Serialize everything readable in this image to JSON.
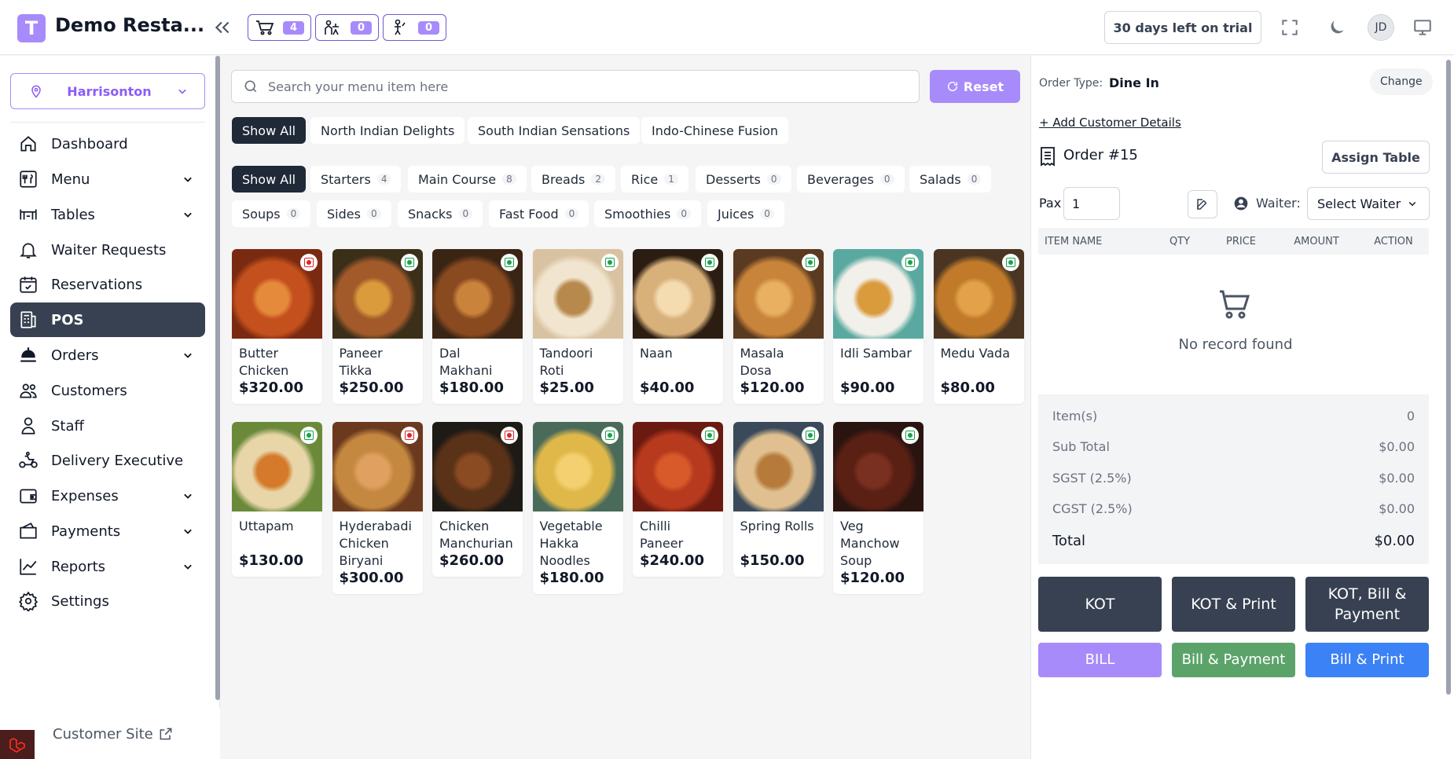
{
  "app": {
    "logo_letter": "T",
    "title": "Demo Resta...",
    "counters": [
      {
        "icon": "cart-icon",
        "value": "4"
      },
      {
        "icon": "waiter-request-icon",
        "value": "0"
      },
      {
        "icon": "table-request-icon",
        "value": "0"
      }
    ],
    "trial_text": "30 days left on trial",
    "avatar_initials": "JD"
  },
  "sidebar": {
    "branch": "Harrisonton",
    "items": [
      {
        "label": "Dashboard",
        "icon": "home-icon",
        "has_children": false
      },
      {
        "label": "Menu",
        "icon": "menu-icon",
        "has_children": true
      },
      {
        "label": "Tables",
        "icon": "table-icon",
        "has_children": true
      },
      {
        "label": "Waiter Requests",
        "icon": "bell-icon",
        "has_children": false
      },
      {
        "label": "Reservations",
        "icon": "calendar-icon",
        "has_children": false
      },
      {
        "label": "POS",
        "icon": "pos-icon",
        "has_children": false,
        "active": true
      },
      {
        "label": "Orders",
        "icon": "orders-icon",
        "has_children": true
      },
      {
        "label": "Customers",
        "icon": "users-icon",
        "has_children": false
      },
      {
        "label": "Staff",
        "icon": "staff-icon",
        "has_children": false
      },
      {
        "label": "Delivery Executive",
        "icon": "delivery-icon",
        "has_children": false
      },
      {
        "label": "Expenses",
        "icon": "wallet-icon",
        "has_children": true
      },
      {
        "label": "Payments",
        "icon": "payments-icon",
        "has_children": true
      },
      {
        "label": "Reports",
        "icon": "chart-icon",
        "has_children": true
      },
      {
        "label": "Settings",
        "icon": "gear-icon",
        "has_children": false
      }
    ],
    "customer_site": "Customer Site"
  },
  "search": {
    "placeholder": "Search your menu item here",
    "value": ""
  },
  "reset_label": "Reset",
  "menus": [
    "Show All",
    "North Indian Delights",
    "South Indian Sensations",
    "Indo-Chinese Fusion"
  ],
  "categories": [
    {
      "label": "Show All"
    },
    {
      "label": "Starters",
      "count": "4"
    },
    {
      "label": "Main Course",
      "count": "8"
    },
    {
      "label": "Breads",
      "count": "2"
    },
    {
      "label": "Rice",
      "count": "1"
    },
    {
      "label": "Desserts",
      "count": "0"
    },
    {
      "label": "Beverages",
      "count": "0"
    },
    {
      "label": "Salads",
      "count": "0"
    },
    {
      "label": "Soups",
      "count": "0"
    },
    {
      "label": "Sides",
      "count": "0"
    },
    {
      "label": "Snacks",
      "count": "0"
    },
    {
      "label": "Fast Food",
      "count": "0"
    },
    {
      "label": "Smoothies",
      "count": "0"
    },
    {
      "label": "Juices",
      "count": "0"
    }
  ],
  "items": [
    {
      "name": "Butter Chicken",
      "price": "$320.00",
      "type": "non-veg"
    },
    {
      "name": "Paneer Tikka",
      "price": "$250.00",
      "type": "veg"
    },
    {
      "name": "Dal Makhani",
      "price": "$180.00",
      "type": "veg"
    },
    {
      "name": "Tandoori Roti",
      "price": "$25.00",
      "type": "veg"
    },
    {
      "name": "Naan",
      "price": "$40.00",
      "type": "veg"
    },
    {
      "name": "Masala Dosa",
      "price": "$120.00",
      "type": "veg"
    },
    {
      "name": "Idli Sambar",
      "price": "$90.00",
      "type": "veg"
    },
    {
      "name": "Medu Vada",
      "price": "$80.00",
      "type": "veg"
    },
    {
      "name": "Uttapam",
      "price": "$130.00",
      "type": "veg"
    },
    {
      "name": "Hyderabadi Chicken Biryani",
      "price": "$300.00",
      "type": "non-veg"
    },
    {
      "name": "Chicken Manchurian",
      "price": "$260.00",
      "type": "non-veg"
    },
    {
      "name": "Vegetable Hakka Noodles",
      "price": "$180.00",
      "type": "veg"
    },
    {
      "name": "Chilli Paneer",
      "price": "$240.00",
      "type": "veg"
    },
    {
      "name": "Spring Rolls",
      "price": "$150.00",
      "type": "veg"
    },
    {
      "name": "Veg Manchow Soup",
      "price": "$120.00",
      "type": "veg"
    }
  ],
  "order": {
    "type_label": "Order Type:",
    "type_value": "Dine In",
    "change_label": "Change",
    "add_customer": "+ Add Customer Details",
    "title": "Order #15",
    "assign_table": "Assign Table",
    "pax_label": "Pax",
    "pax_value": "1",
    "waiter_label": "Waiter:",
    "waiter_select": "Select Waiter",
    "columns": [
      "ITEM NAME",
      "QTY",
      "PRICE",
      "AMOUNT",
      "ACTION"
    ],
    "empty_text": "No record found",
    "summary": [
      {
        "label": "Item(s)",
        "value": "0"
      },
      {
        "label": "Sub Total",
        "value": "$0.00"
      },
      {
        "label": "SGST (2.5%)",
        "value": "$0.00"
      },
      {
        "label": "CGST (2.5%)",
        "value": "$0.00"
      }
    ],
    "total_label": "Total",
    "total_value": "$0.00",
    "buttons": {
      "kot": "KOT",
      "kot_print": "KOT & Print",
      "kot_bill_payment": "KOT, Bill & Payment",
      "bill": "BILL",
      "bill_payment": "Bill & Payment",
      "bill_print": "Bill & Print"
    }
  },
  "colors": {
    "accent": "#a78bfa",
    "dark": "#374151",
    "green_btn": "#5ca36a",
    "blue_btn": "#3b82f6",
    "veg": "#16a34a",
    "nonveg": "#dc2626"
  }
}
